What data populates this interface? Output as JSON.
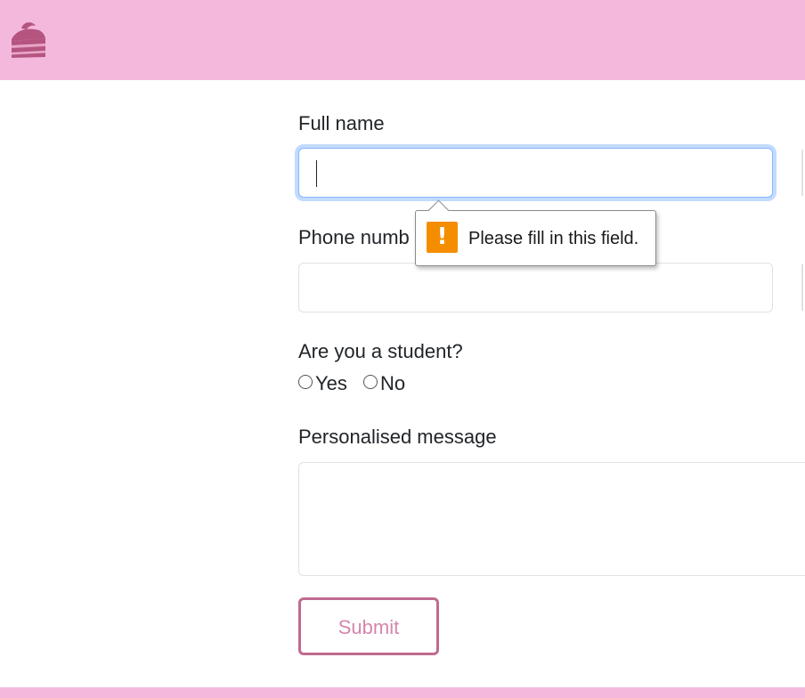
{
  "header": {
    "logo_icon": "cake-slice-icon",
    "background_color": "#f5b8dd",
    "logo_color": "#b5557f"
  },
  "form": {
    "full_name": {
      "label": "Full name",
      "value": ""
    },
    "phone": {
      "label": "Phone numb",
      "value": ""
    },
    "student": {
      "label": "Are you a student?",
      "options": [
        "Yes",
        "No"
      ]
    },
    "message": {
      "label": "Personalised message",
      "value": ""
    },
    "submit_label": "Submit"
  },
  "validation_tooltip": {
    "icon": "warning-icon",
    "icon_glyph": "!",
    "message": "Please fill in this field."
  },
  "colors": {
    "accent": "#c06a90",
    "submit_text": "#d486ac",
    "warning": "#f58d00"
  }
}
